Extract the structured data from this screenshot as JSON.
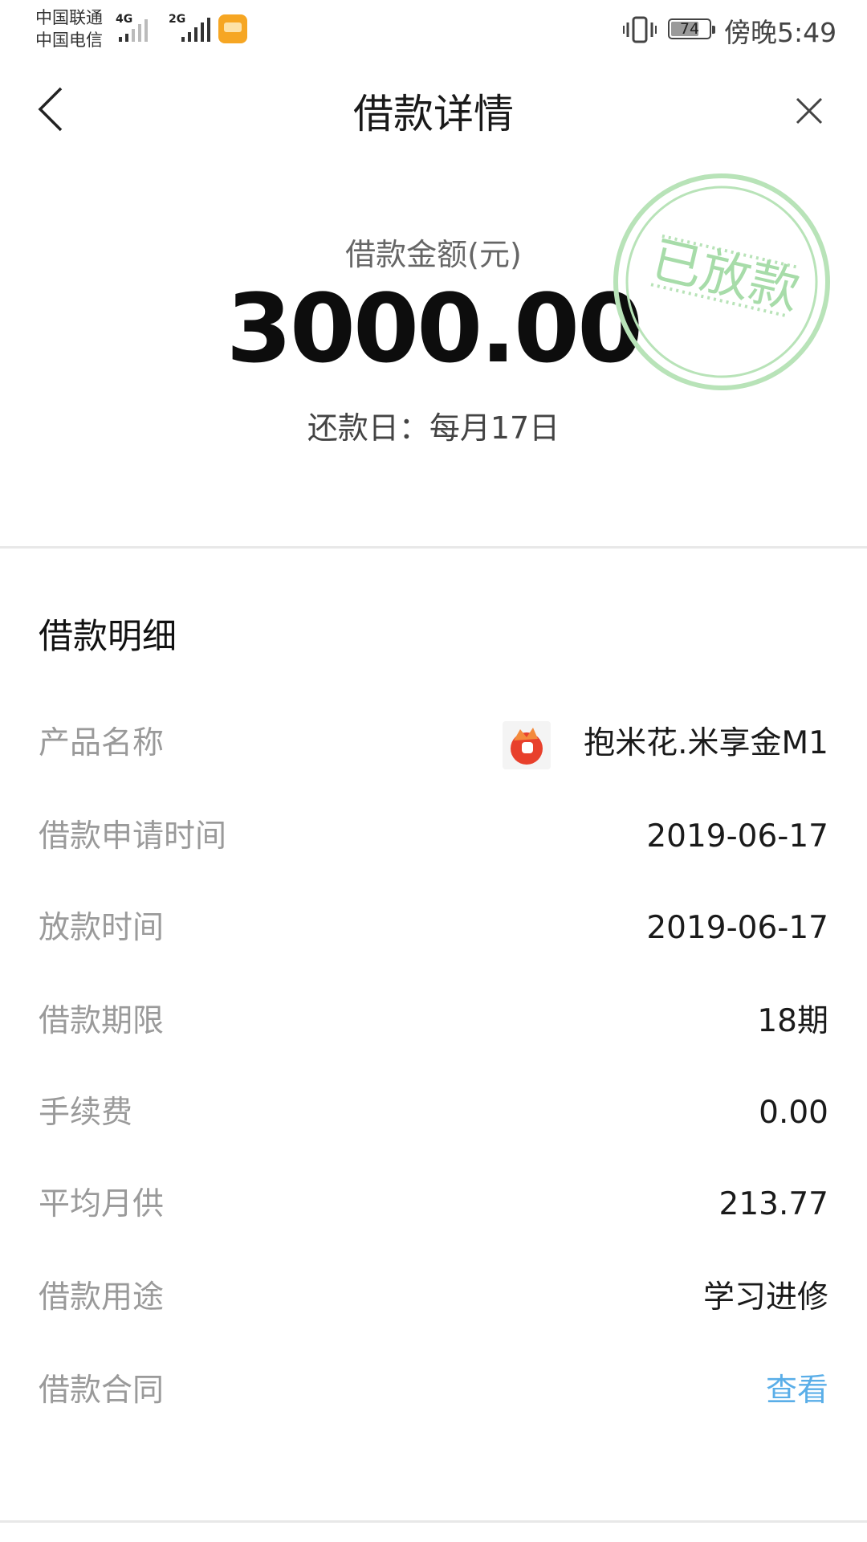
{
  "status_bar": {
    "carrier_1": "中国联通",
    "carrier_2": "中国电信",
    "network_1": "4G",
    "network_2": "2G",
    "battery": "74",
    "time": "傍晚5:49"
  },
  "nav": {
    "title": "借款详情",
    "back_icon": "chevron-left-icon",
    "close_icon": "close-icon"
  },
  "summary": {
    "amount_label": "借款金额(元)",
    "amount": "3000.00",
    "repay_day": "还款日：每月17日",
    "stamp_text": "已放款",
    "stamp_color": "#9fd9a2"
  },
  "details": {
    "title": "借款明细",
    "rows": [
      {
        "label": "产品名称",
        "value": "抱米花.米享金M1",
        "icon": "popcorn-logo-icon"
      },
      {
        "label": "借款申请时间",
        "value": "2019-06-17"
      },
      {
        "label": "放款时间",
        "value": "2019-06-17"
      },
      {
        "label": "借款期限",
        "value": "18期"
      },
      {
        "label": "手续费",
        "value": "0.00"
      },
      {
        "label": "平均月供",
        "value": "213.77"
      },
      {
        "label": "借款用途",
        "value": "学习进修"
      },
      {
        "label": "借款合同",
        "value": "查看"
      }
    ]
  },
  "colors": {
    "label_gray": "#9a9a9a",
    "link_blue": "#5aaee8",
    "stamp_green": "#9fd9a2"
  }
}
